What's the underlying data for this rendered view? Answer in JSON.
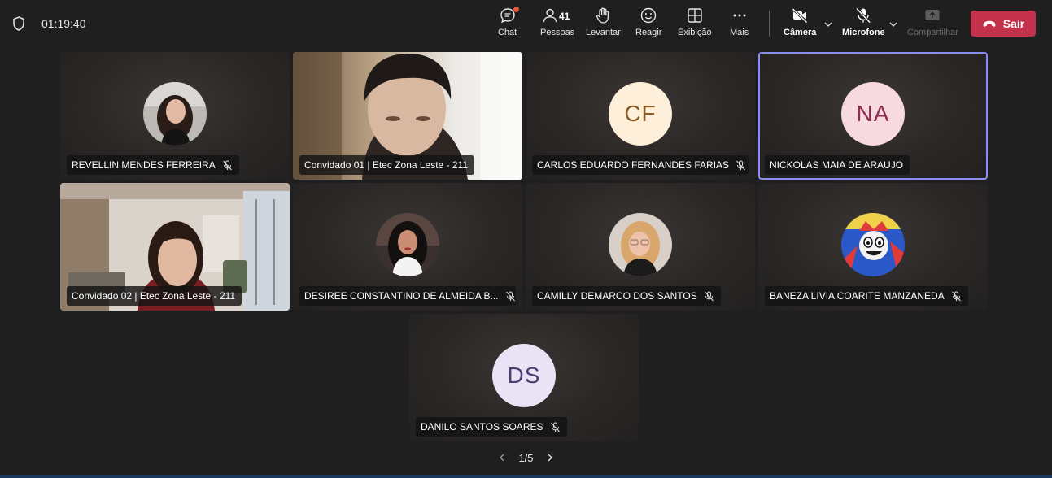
{
  "meeting": {
    "elapsed_time": "01:19:40"
  },
  "toolbar": {
    "chat_label": "Chat",
    "people_label": "Pessoas",
    "people_count": "41",
    "raise_label": "Levantar",
    "react_label": "Reagir",
    "view_label": "Exibição",
    "more_label": "Mais",
    "camera_label": "Câmera",
    "mic_label": "Microfone",
    "share_label": "Compartilhar",
    "leave_label": "Sair"
  },
  "participants": [
    {
      "name": "REVELLIN MENDES FERREIRA",
      "muted": true,
      "type": "photo-avatar"
    },
    {
      "name": "Convidado 01 | Etec Zona Leste - 211",
      "muted": false,
      "type": "video",
      "active": true
    },
    {
      "name": "CARLOS EDUARDO FERNANDES FARIAS",
      "muted": true,
      "type": "initials",
      "initials": "CF",
      "avatar_bg": "#fdefd9",
      "avatar_fg": "#8a5a24"
    },
    {
      "name": "NICKOLAS MAIA DE ARAUJO",
      "muted": false,
      "type": "initials",
      "initials": "NA",
      "avatar_bg": "#f6d9e1",
      "avatar_fg": "#8a2c4a",
      "active": true
    },
    {
      "name": "Convidado 02 | Etec Zona Leste - 211",
      "muted": false,
      "type": "video"
    },
    {
      "name": "DESIREE CONSTANTINO DE ALMEIDA B...",
      "muted": true,
      "type": "photo-avatar"
    },
    {
      "name": "CAMILLY DEMARCO DOS SANTOS",
      "muted": true,
      "type": "photo-avatar"
    },
    {
      "name": "BANEZA LIVIA COARITE MANZANEDA",
      "muted": true,
      "type": "photo-avatar"
    },
    {
      "name": "DANILO SANTOS SOARES",
      "muted": true,
      "type": "initials",
      "initials": "DS",
      "avatar_bg": "#e9e4f5",
      "avatar_fg": "#4b3f72"
    }
  ],
  "pagination": {
    "label": "1/5"
  },
  "colors": {
    "accent_active": "#8b8cf0",
    "leave": "#c4314b",
    "background": "#1f1f1f"
  }
}
